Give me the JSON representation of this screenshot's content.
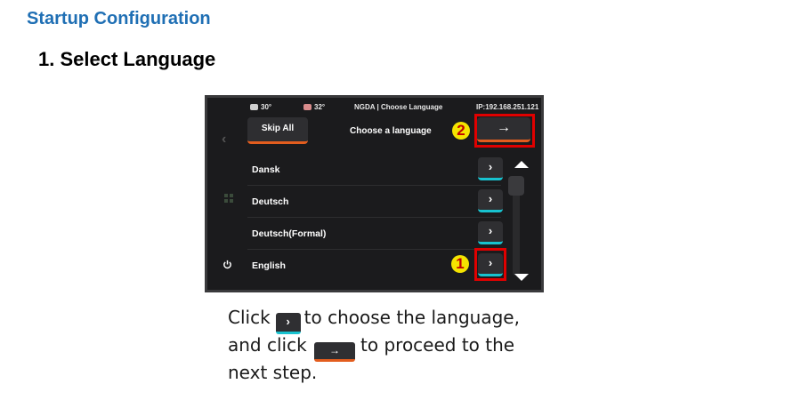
{
  "doc": {
    "section_title": "Startup Configuration",
    "step_title": "1. Select Language"
  },
  "screen": {
    "status": {
      "temp1": "30°",
      "temp2": "32°",
      "title": "NGDA | Choose Language",
      "ip": "IP:192.168.251.121"
    },
    "skip_label": "Skip All",
    "heading": "Choose a language",
    "next_glyph": "→",
    "chevron_glyph": "›",
    "languages": [
      "Dansk",
      "Deutsch",
      "Deutsch(Formal)",
      "English"
    ],
    "callouts": {
      "one": "1",
      "two": "2"
    }
  },
  "instructions": {
    "line1_a": "Click",
    "line1_b": "to choose the language,",
    "line2_a": "and click",
    "line2_b": "to proceed to the",
    "line3": "next step."
  },
  "colors": {
    "title_blue": "#1f6fb4",
    "highlight_red": "#e00000",
    "badge_yellow": "#f5e400",
    "accent_orange": "#e35d1e",
    "accent_cyan": "#18c2cf"
  },
  "icons": {
    "left": "chevron-left-icon",
    "apps": "apps-grid-icon",
    "power": "power-icon",
    "next": "arrow-right-icon",
    "select": "chevron-right-icon"
  }
}
